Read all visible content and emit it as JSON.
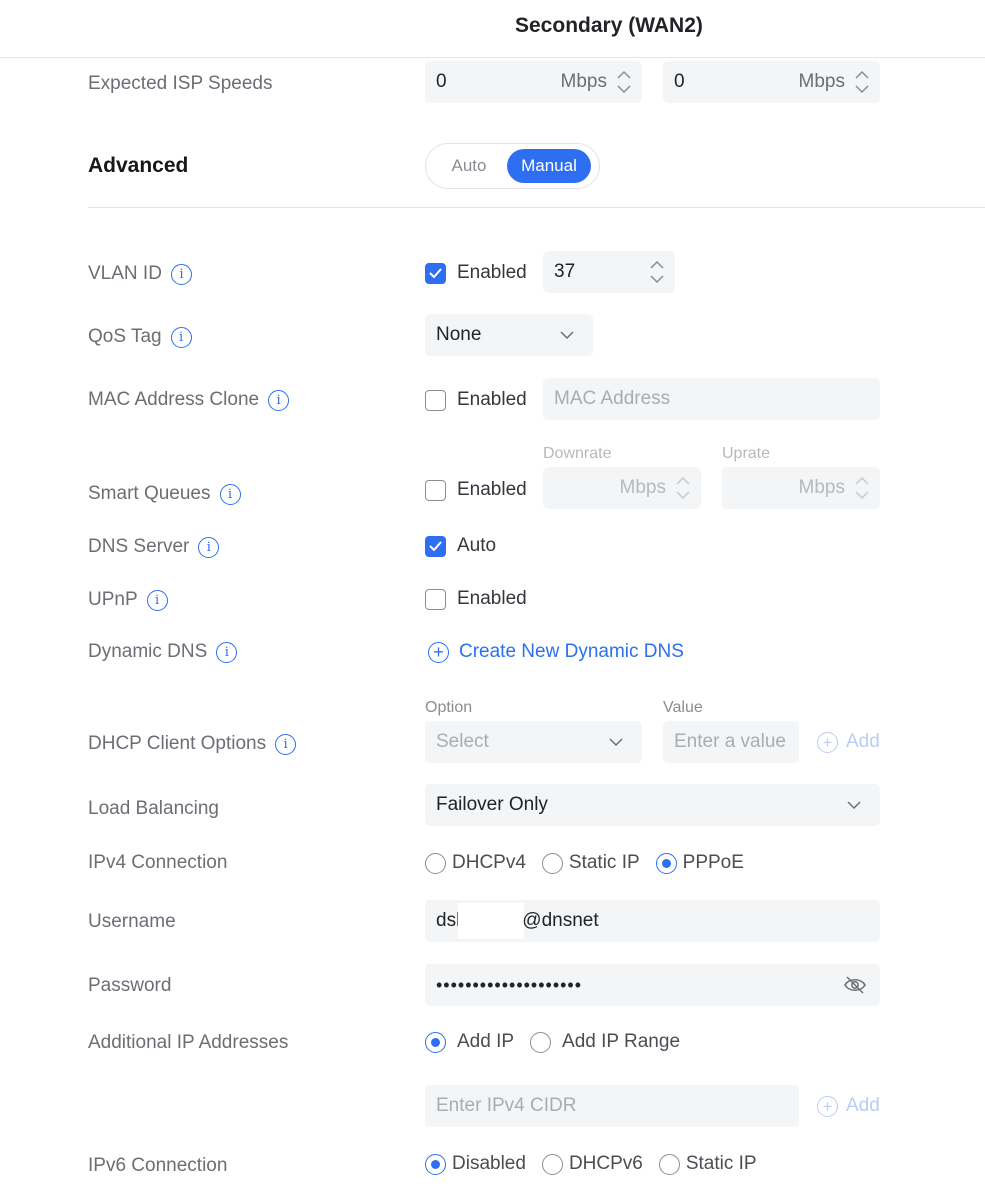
{
  "header": {
    "title": "Secondary (WAN2)"
  },
  "isp_speeds": {
    "label": "Expected ISP Speeds",
    "down_value": "0",
    "up_value": "0",
    "unit": "Mbps"
  },
  "advanced": {
    "label": "Advanced",
    "options": [
      "Auto",
      "Manual"
    ],
    "selected": "Manual"
  },
  "vlan": {
    "label": "VLAN ID",
    "checked": true,
    "check_label": "Enabled",
    "value": "37"
  },
  "qos": {
    "label": "QoS Tag",
    "selected": "None"
  },
  "mac_clone": {
    "label": "MAC Address Clone",
    "checked": false,
    "check_label": "Enabled",
    "placeholder": "MAC Address"
  },
  "smart_queues": {
    "label": "Smart Queues",
    "checked": false,
    "check_label": "Enabled",
    "downrate_label": "Downrate",
    "uprate_label": "Uprate",
    "unit": "Mbps"
  },
  "dns_server": {
    "label": "DNS Server",
    "checked": true,
    "check_label": "Auto"
  },
  "upnp": {
    "label": "UPnP",
    "checked": false,
    "check_label": "Enabled"
  },
  "dynamic_dns": {
    "label": "Dynamic DNS",
    "link": "Create New Dynamic DNS"
  },
  "dhcp_client": {
    "label": "DHCP Client Options",
    "option_label": "Option",
    "value_label": "Value",
    "option_placeholder": "Select",
    "value_placeholder": "Enter a value",
    "add_label": "Add"
  },
  "load_balancing": {
    "label": "Load Balancing",
    "selected": "Failover Only"
  },
  "ipv4": {
    "label": "IPv4 Connection",
    "options": [
      "DHCPv4",
      "Static IP",
      "PPPoE"
    ],
    "selected": "PPPoE"
  },
  "username": {
    "label": "Username",
    "value_prefix": "dsl",
    "value_suffix": "@dnsnet"
  },
  "password": {
    "label": "Password",
    "masked": "••••••••••••••••••••"
  },
  "additional_ip": {
    "label": "Additional IP Addresses",
    "options": [
      "Add IP",
      "Add IP Range"
    ],
    "selected": "Add IP",
    "cidr_placeholder": "Enter IPv4 CIDR",
    "add_label": "Add"
  },
  "ipv6": {
    "label": "IPv6 Connection",
    "options": [
      "Disabled",
      "DHCPv6",
      "Static IP"
    ],
    "selected": "Disabled"
  },
  "colors": {
    "accent": "#2d6ff0",
    "label": "#6b6e74",
    "field_bg": "#f4f5f6"
  }
}
